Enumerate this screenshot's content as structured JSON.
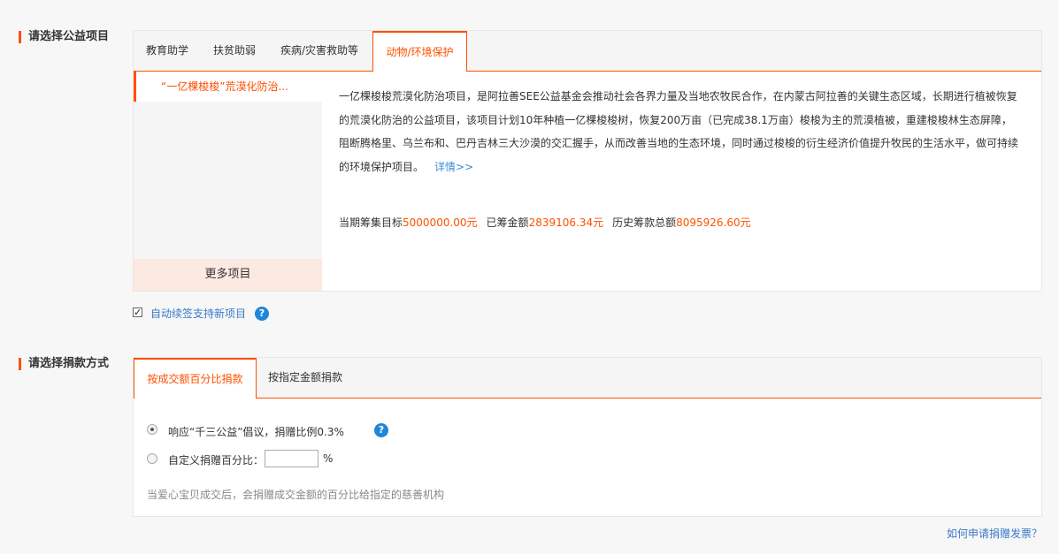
{
  "sections": {
    "project_title": "请选择公益项目",
    "method_title": "请选择捐款方式"
  },
  "project_tabs": [
    "教育助学",
    "扶贫助弱",
    "疾病/灾害救助等",
    "动物/环境保护"
  ],
  "active_project_tab": 3,
  "project_list": {
    "items": [
      "“一亿棵梭梭”荒漠化防治..."
    ],
    "more_label": "更多项目"
  },
  "project": {
    "description": "一亿棵梭梭荒漠化防治项目，是阿拉善SEE公益基金会推动社会各界力量及当地农牧民合作，在内蒙古阿拉善的关键生态区域，长期进行植被恢复的荒漠化防治的公益项目，该项目计划10年种植一亿棵梭梭树，恢复200万亩（已完成38.1万亩）梭梭为主的荒漠植被，重建梭梭林生态屏障，阻断腾格里、乌兰布和、巴丹吉林三大沙漠的交汇握手，从而改善当地的生态环境，同时通过梭梭的衍生经济价值提升牧民的生活水平，做可持续的环境保护项目。",
    "detail_link": "详情>>",
    "stats": {
      "target_label": "当期筹集目标",
      "target_value": "5000000.00元",
      "raised_label": "已筹金额",
      "raised_value": "2839106.34元",
      "history_label": "历史筹款总额",
      "history_value": "8095926.60元"
    }
  },
  "auto_renew": {
    "label": "自动续签支持新项目",
    "checked": true,
    "help_icon": "?"
  },
  "method_tabs": [
    "按成交额百分比捐款",
    "按指定金额捐款"
  ],
  "active_method_tab": 0,
  "method_options": {
    "option1_label": "响应“千三公益”倡议，捐赠比例0.3%",
    "option1_checked": true,
    "option2_label": "自定义捐赠百分比：",
    "option2_checked": false,
    "percent_value": "",
    "percent_unit": "%",
    "help_icon": "?"
  },
  "note": "当爱心宝贝成交后，会捐赠成交金额的百分比给指定的慈善机构",
  "invoice_link": "如何申请捐赠发票？",
  "colors": {
    "accent": "#ff5000",
    "link": "#3a79c7",
    "help": "#1f86d8"
  }
}
